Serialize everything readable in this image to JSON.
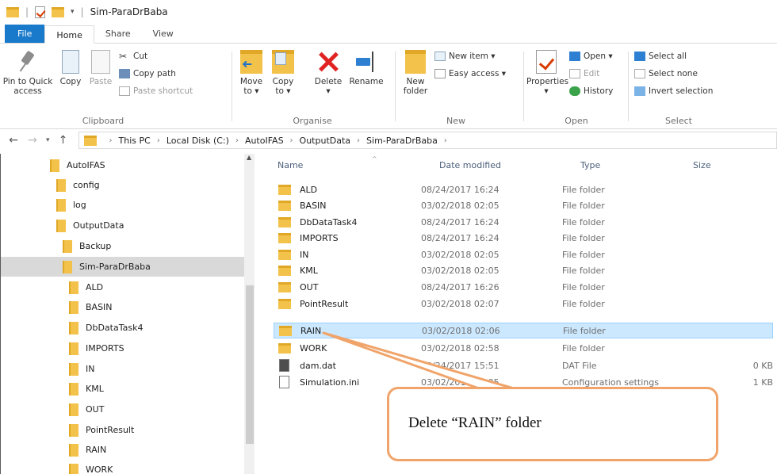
{
  "window": {
    "title": "Sim-ParaDrBaba"
  },
  "tabs": [
    {
      "label": "File"
    },
    {
      "label": "Home"
    },
    {
      "label": "Share"
    },
    {
      "label": "View"
    }
  ],
  "ribbon": {
    "clipboard": {
      "label": "Clipboard",
      "pin": "Pin to Quick\naccess",
      "copy": "Copy",
      "paste": "Paste",
      "cut": "Cut",
      "copy_path": "Copy path",
      "paste_shortcut": "Paste shortcut"
    },
    "organise": {
      "label": "Organise",
      "move_to": "Move\nto ▾",
      "copy_to": "Copy\nto ▾",
      "delete": "Delete\n▾",
      "rename": "Rename"
    },
    "new": {
      "label": "New",
      "new_folder": "New\nfolder",
      "new_item": "New item ▾",
      "easy_access": "Easy access ▾"
    },
    "open": {
      "label": "Open",
      "properties": "Properties\n▾",
      "open": "Open ▾",
      "edit": "Edit",
      "history": "History"
    },
    "select": {
      "label": "Select",
      "select_all": "Select all",
      "select_none": "Select none",
      "invert_selection": "Invert selection"
    }
  },
  "address": {
    "crumbs": [
      "This PC",
      "Local Disk (C:)",
      "AutoIFAS",
      "OutputData",
      "Sim-ParaDrBaba"
    ]
  },
  "nav_pane": {
    "items": [
      {
        "label": "AutoIFAS",
        "level": 0
      },
      {
        "label": "config",
        "level": 1
      },
      {
        "label": "log",
        "level": 1
      },
      {
        "label": "OutputData",
        "level": 1
      },
      {
        "label": "Backup",
        "level": 2
      },
      {
        "label": "Sim-ParaDrBaba",
        "level": 2,
        "selected": true
      },
      {
        "label": "ALD",
        "level": 3
      },
      {
        "label": "BASIN",
        "level": 3
      },
      {
        "label": "DbDataTask4",
        "level": 3
      },
      {
        "label": "IMPORTS",
        "level": 3
      },
      {
        "label": "IN",
        "level": 3
      },
      {
        "label": "KML",
        "level": 3
      },
      {
        "label": "OUT",
        "level": 3
      },
      {
        "label": "PointResult",
        "level": 3
      },
      {
        "label": "RAIN",
        "level": 3
      },
      {
        "label": "WORK",
        "level": 3
      }
    ]
  },
  "file_list": {
    "columns": {
      "name": "Name",
      "date": "Date modified",
      "type": "Type",
      "size": "Size"
    },
    "rows": [
      {
        "name": "ALD",
        "date": "08/24/2017 16:24",
        "type": "File folder",
        "size": "",
        "kind": "folder"
      },
      {
        "name": "BASIN",
        "date": "03/02/2018 02:05",
        "type": "File folder",
        "size": "",
        "kind": "folder"
      },
      {
        "name": "DbDataTask4",
        "date": "08/24/2017 16:24",
        "type": "File folder",
        "size": "",
        "kind": "folder"
      },
      {
        "name": "IMPORTS",
        "date": "08/24/2017 16:24",
        "type": "File folder",
        "size": "",
        "kind": "folder"
      },
      {
        "name": "IN",
        "date": "03/02/2018 02:05",
        "type": "File folder",
        "size": "",
        "kind": "folder"
      },
      {
        "name": "KML",
        "date": "03/02/2018 02:05",
        "type": "File folder",
        "size": "",
        "kind": "folder"
      },
      {
        "name": "OUT",
        "date": "08/24/2017 16:26",
        "type": "File folder",
        "size": "",
        "kind": "folder"
      },
      {
        "name": "PointResult",
        "date": "03/02/2018 02:07",
        "type": "File folder",
        "size": "",
        "kind": "folder"
      },
      {
        "name": "RAIN",
        "date": "03/02/2018 02:06",
        "type": "File folder",
        "size": "",
        "kind": "folder",
        "selected": true
      },
      {
        "name": "WORK",
        "date": "03/02/2018 02:58",
        "type": "File folder",
        "size": "",
        "kind": "folder"
      },
      {
        "name": "dam.dat",
        "date": "08/24/2017 15:51",
        "type": "DAT File",
        "size": "0 KB",
        "kind": "dat"
      },
      {
        "name": "Simulation.ini",
        "date": "03/02/2018 02:05",
        "type": "Configuration settings",
        "size": "1 KB",
        "kind": "ini"
      }
    ]
  },
  "callout": {
    "text": "Delete “RAIN” folder",
    "color": "#f0a46a"
  }
}
